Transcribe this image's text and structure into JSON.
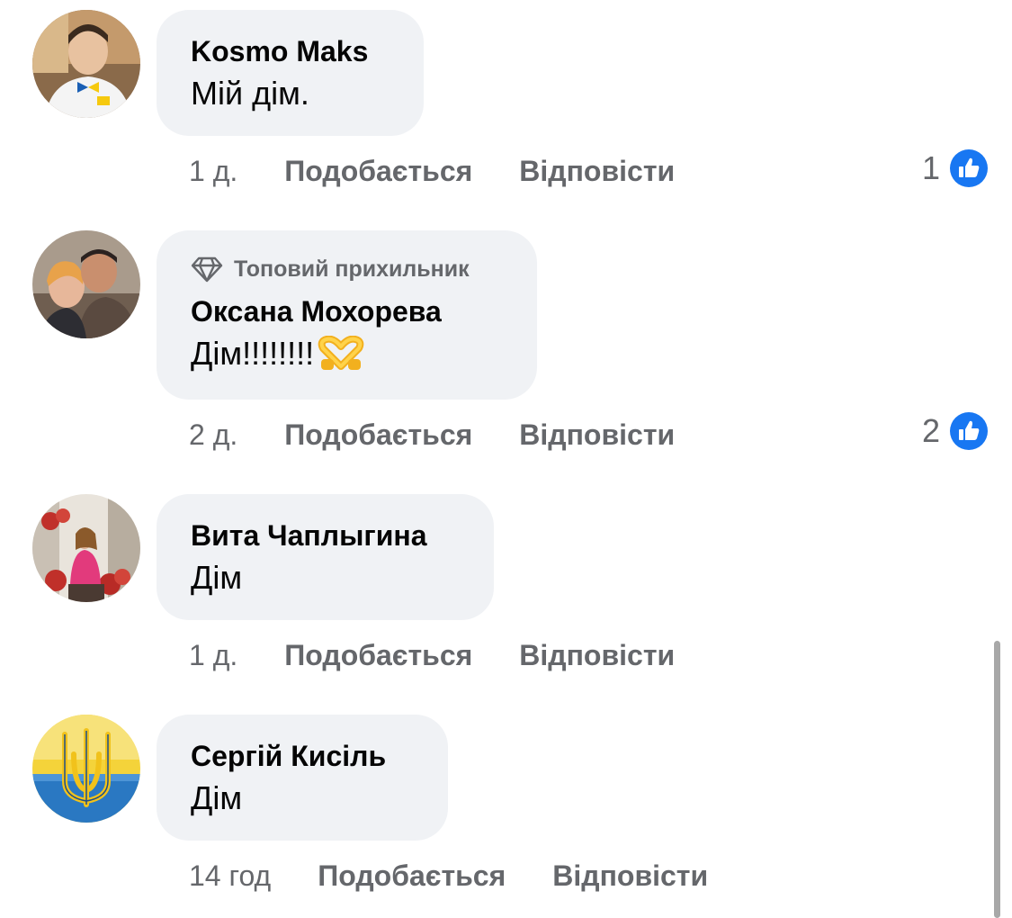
{
  "comments": [
    {
      "author": "Kosmo Maks",
      "badge": "",
      "text": "Мій дім.",
      "time": "1 д.",
      "like_label": "Подобається",
      "reply_label": "Відповісти",
      "reaction_count": "1",
      "avatar_icon": "person-photo-avatar"
    },
    {
      "author": "Оксана Мохорева",
      "badge": "Топовий прихильник",
      "text": "Дім!!!!!!!!",
      "emoji_icon": "heart-hands-icon",
      "time": "2 д.",
      "like_label": "Подобається",
      "reply_label": "Відповісти",
      "reaction_count": "2",
      "avatar_icon": "couple-photo-avatar"
    },
    {
      "author": "Вита Чаплыгина",
      "badge": "",
      "text": "Дім",
      "time": "1 д.",
      "like_label": "Подобається",
      "reply_label": "Відповісти",
      "reaction_count": "",
      "avatar_icon": "woman-photo-avatar"
    },
    {
      "author": "Сергій Кисіль",
      "badge": "",
      "text": "Дім",
      "time": "14 год",
      "like_label": "Подобається",
      "reply_label": "Відповісти",
      "reaction_count": "",
      "avatar_icon": "ukraine-trident-avatar"
    }
  ],
  "colors": {
    "bubble": "#f0f2f5",
    "meta_text": "#65676b",
    "like_blue": "#1877f2"
  }
}
